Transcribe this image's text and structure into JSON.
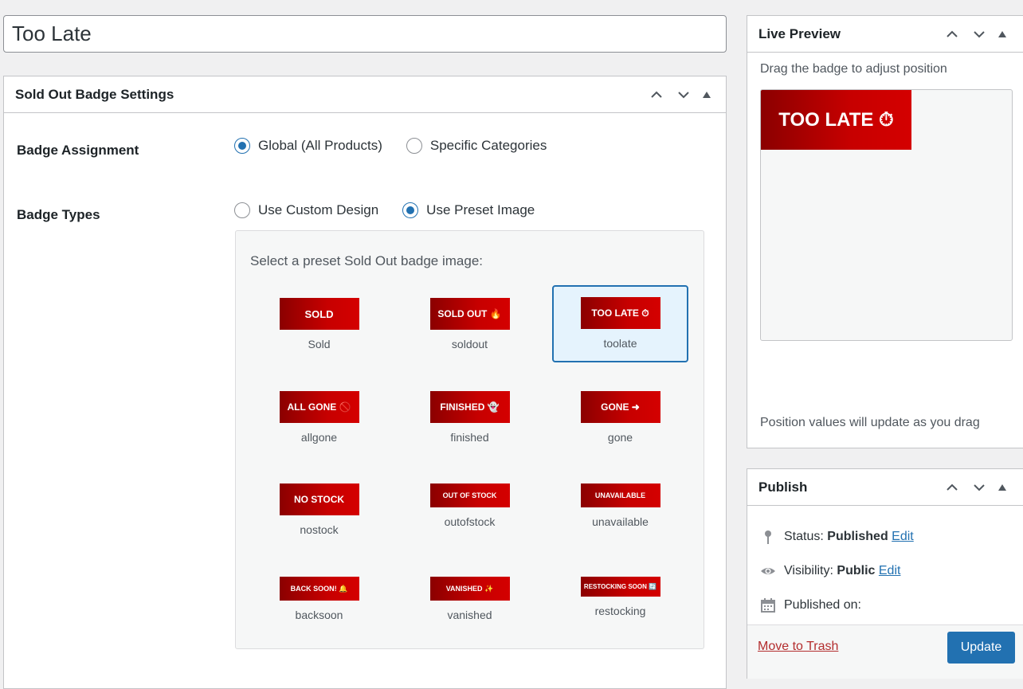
{
  "post_title": "Too Late",
  "settings": {
    "title": "Sold Out Badge Settings",
    "assignment": {
      "label": "Badge Assignment",
      "options": [
        "Global (All Products)",
        "Specific Categories"
      ],
      "selected": "Global (All Products)"
    },
    "types": {
      "label": "Badge Types",
      "options": [
        "Use Custom Design",
        "Use Preset Image"
      ],
      "selected": "Use Preset Image"
    },
    "preset_prompt": "Select a preset Sold Out badge image:",
    "presets": [
      {
        "badge": "SOLD",
        "label": "Sold"
      },
      {
        "badge": "SOLD OUT 🔥",
        "label": "soldout"
      },
      {
        "badge": "TOO LATE ⏱",
        "label": "toolate",
        "selected": true
      },
      {
        "badge": "ALL GONE 🚫",
        "label": "allgone"
      },
      {
        "badge": "FINISHED 👻",
        "label": "finished"
      },
      {
        "badge": "GONE ➜",
        "label": "gone"
      },
      {
        "badge": "NO STOCK",
        "label": "nostock"
      },
      {
        "badge": "OUT OF STOCK",
        "label": "outofstock"
      },
      {
        "badge": "UNAVAILABLE",
        "label": "unavailable"
      },
      {
        "badge": "BACK SOON! 🔔",
        "label": "backsoon"
      },
      {
        "badge": "VANISHED ✨",
        "label": "vanished"
      },
      {
        "badge": "RESTOCKING SOON 🔄",
        "label": "restocking"
      }
    ]
  },
  "preview": {
    "title": "Live Preview",
    "hint": "Drag the badge to adjust position",
    "badge_text": "TOO LATE ⏱",
    "footer": "Position values will update as you drag"
  },
  "publish": {
    "title": "Publish",
    "status_label": "Status:",
    "status_value": "Published",
    "visibility_label": "Visibility:",
    "visibility_value": "Public",
    "edit_label": "Edit",
    "published_on_label": "Published on:",
    "trash_label": "Move to Trash",
    "update_label": "Update"
  },
  "colors": {
    "accent": "#2271b1",
    "badge_red": "#c70000",
    "trash": "#b32d2e"
  }
}
